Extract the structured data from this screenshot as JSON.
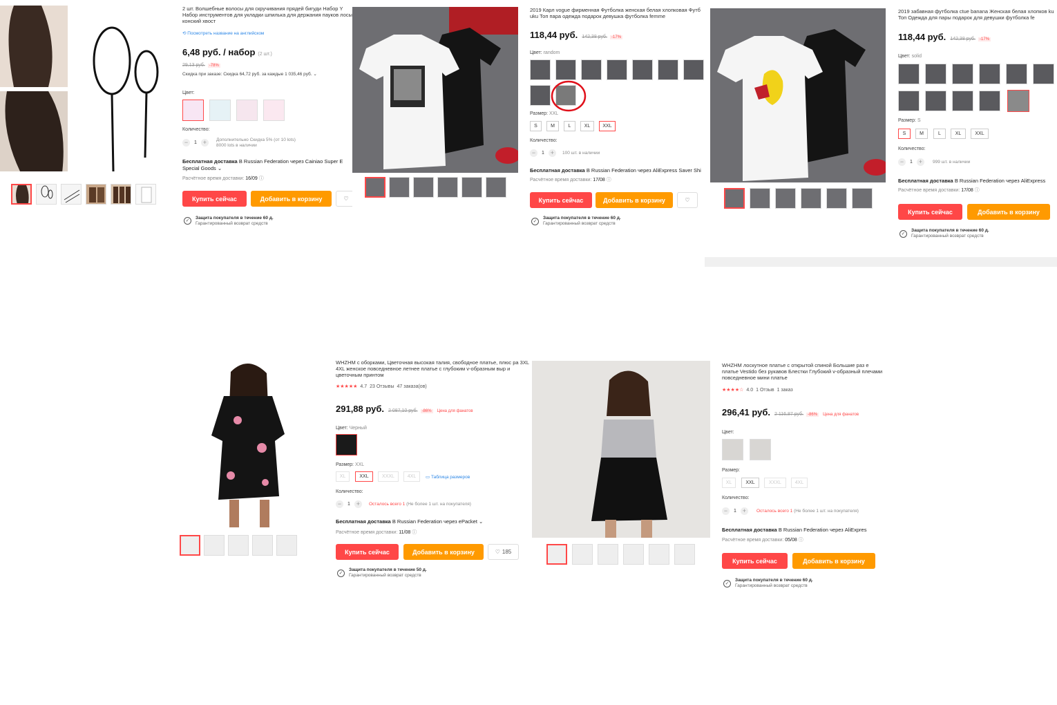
{
  "p1": {
    "title": "2 шт. Волшебные волосы для скручивания прядей бигуди Набор Y Набор инструментов для укладки шпилька для держания пауков лосы конский хвост",
    "english_link": "Посмотреть название на английском",
    "price": "6,48 руб. / набор",
    "price_unit": "(2 шт.)",
    "old_price": "29,13 руб.",
    "discount": "-78%",
    "order_discount": "Скидка при заказе: Скидка 64,72 руб. за каждые 1 035,46 руб. ⌄",
    "color_label": "Цвет:",
    "qty_label": "Количество:",
    "qty_value": "1",
    "qty_note1": "Дополнительно Скидка 5% (от 10 lots)",
    "qty_note2": "8000 lots в наличии",
    "ship_bold": "Бесплатная доставка",
    "ship_rest": " В Russian Federation через Cainiao Super E",
    "ship_rest2": "Special Goods ⌄",
    "est_label": "Расчётное время доставки:",
    "est_date": "16/09",
    "buy": "Купить сейчас",
    "cart": "Добавить в корзину",
    "protect1": "Защита покупателя в течение 60 д.",
    "protect2": "Гарантированный возврат средств"
  },
  "p2": {
    "title": "2019 Карл vogue фирменная Футболка женская белая хлопковая Футб uku Топ пара одежда подарок девушка футболка femme",
    "price": "118,44 руб.",
    "old_price": "142,38 руб.",
    "discount": "-17%",
    "color_label": "Цвет:",
    "color_value": "random",
    "size_label": "Размер:",
    "size_value": "XXL",
    "sizes": [
      "S",
      "M",
      "L",
      "XL",
      "XXL"
    ],
    "qty_label": "Количество:",
    "qty_value": "1",
    "qty_note": "100 шт. в наличии",
    "ship_bold": "Бесплатная доставка",
    "ship_rest": " В Russian Federation через AliExpress Saver Shi",
    "est_label": "Расчётное время доставки:",
    "est_date": "17/08",
    "buy": "Купить сейчас",
    "cart": "Добавить в корзину",
    "protect1": "Защита покупателя в течение 60 д.",
    "protect2": "Гарантированный возврат средств"
  },
  "p3": {
    "title": "2019 забавная футболка ctue banana Женская белая хлопков ku Топ Одежда для пары подарок для девушки футболка fe",
    "price": "118,44 руб.",
    "old_price": "142,38 руб.",
    "discount": "-17%",
    "color_label": "Цвет:",
    "color_value": "solid",
    "size_label": "Размер:",
    "size_value": "S",
    "sizes": [
      "S",
      "M",
      "L",
      "XL",
      "XXL"
    ],
    "qty_label": "Количество:",
    "qty_value": "1",
    "qty_note": "999 шт. в наличии",
    "ship_bold": "Бесплатная доставка",
    "ship_rest": " В Russian Federation через AliExpress",
    "est_label": "Расчётное время доставки:",
    "est_date": "17/08",
    "buy": "Купить сейчас",
    "cart": "Добавить в корзину",
    "protect1": "Защита покупателя в течение 60 д.",
    "protect2": "Гарантированный возврат средств"
  },
  "p4": {
    "title": "WHZHM с оборками, Цветочная высокая талия, свободное платье, плюс ра 3XL 4XL женское повседневное летнее платье с глубоким v-образным выр и цветочным принтом",
    "rating": "4.7",
    "reviews": "23 Отзывы",
    "orders": "47 заказа(ов)",
    "price": "291,88 руб.",
    "old_price": "2 087,10 руб.",
    "discount": "-86%",
    "fan": "Цена для фанатов",
    "color_label": "Цвет:",
    "color_value": "Черный",
    "size_label": "Размер:",
    "size_value": "XXL",
    "sizes": [
      "XL",
      "XXL",
      "XXXL",
      "4XL"
    ],
    "size_table": "Таблица размеров",
    "qty_label": "Количество:",
    "qty_value": "1",
    "qty_left": "Осталось всего 1",
    "qty_limit": " (Не более 1 шт. на покупателя)",
    "ship_bold": "Бесплатная доставка",
    "ship_rest": " В Russian Federation через ePacket ⌄",
    "est_label": "Расчётное время доставки:",
    "est_date": "11/08",
    "buy": "Купить сейчас",
    "cart": "Добавить в корзину",
    "wish_count": "185",
    "protect1": "Защита покупателя в течение 50 д.",
    "protect2": "Гарантированный возврат средств"
  },
  "p5": {
    "title": "WHZHM лоскутное платье с открытой спиной Большие раз е платье Vestido без рукавов Блестки Глубокий v-образный плечами повседневное мини платье",
    "rating": "4.0",
    "reviews": "1 Отзыв",
    "orders": "1 заказ",
    "price": "296,41 руб.",
    "old_price": "2 116,87 руб.",
    "discount": "-86%",
    "fan": "Цена для фанатов",
    "color_label": "Цвет:",
    "size_label": "Размер:",
    "sizes": [
      "XL",
      "XXL",
      "XXXL",
      "4XL"
    ],
    "qty_label": "Количество:",
    "qty_value": "1",
    "qty_left": "Осталось всего 1",
    "qty_limit": " (Не более 1 шт. на покупателя)",
    "ship_bold": "Бесплатная доставка",
    "ship_rest": " В Russian Federation через AliExpres",
    "est_label": "Расчётное время доставки:",
    "est_date": "05/08",
    "buy": "Купить сейчас",
    "cart": "Добавить в корзину",
    "protect1": "Защита покупателя в течение 60 д.",
    "protect2": "Гарантированный возврат средств"
  },
  "colors": {
    "accent": "#ff4747",
    "cart": "#ff9a00",
    "link": "#2d87e6"
  }
}
